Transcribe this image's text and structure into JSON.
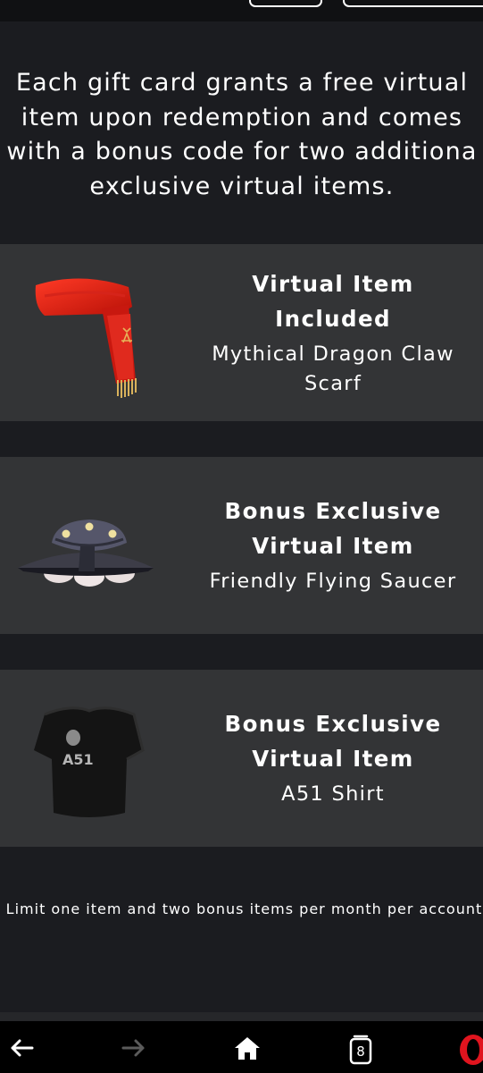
{
  "intro": {
    "line1": "Each gift card grants a free virtual",
    "line2": "item upon redemption and comes",
    "line3": "with a bonus code for two additiona",
    "line4": "exclusive virtual items."
  },
  "items": [
    {
      "title": "Virtual Item Included",
      "name": "Mythical Dragon Claw Scarf",
      "icon": "red-scarf"
    },
    {
      "title": "Bonus Exclusive Virtual Item",
      "name": "Friendly Flying Saucer",
      "icon": "flying-saucer"
    },
    {
      "title": "Bonus Exclusive Virtual Item",
      "name": "A51 Shirt",
      "icon": "a51-shirt"
    }
  ],
  "shirt_print": "A51",
  "limit_text": "Limit one item and two bonus items per month per account.",
  "browser_nav": {
    "tab_count": "8",
    "icons": [
      "back-arrow-icon",
      "forward-arrow-icon",
      "home-icon",
      "tabs-icon",
      "opera-menu-icon"
    ]
  },
  "colors": {
    "page_bg": "#1b1c20",
    "card_bg": "#333436",
    "text": "#ffffff",
    "opera_red": "#e0141e"
  }
}
